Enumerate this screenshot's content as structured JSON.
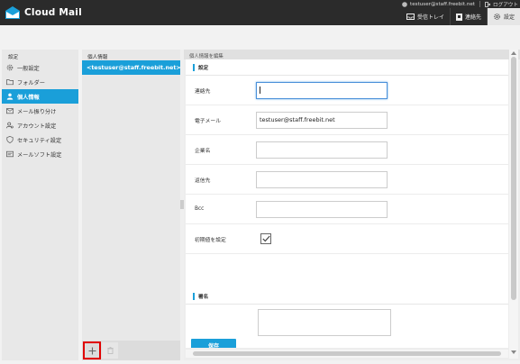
{
  "app": {
    "name": "Cloud Mail"
  },
  "account": {
    "email": "testuser@staff.freebit.net",
    "logout_label": "ログアウト"
  },
  "nav": {
    "inbox_label": "受信トレイ",
    "contacts_label": "連絡先",
    "settings_label": "設定"
  },
  "sidebar": {
    "title": "設定",
    "items": [
      {
        "label": "一般設定",
        "icon": "gear-icon"
      },
      {
        "label": "フォルダー",
        "icon": "folder-icon"
      },
      {
        "label": "個人情報",
        "icon": "person-icon",
        "active": true
      },
      {
        "label": "メール振り分け",
        "icon": "mail-filter-icon"
      },
      {
        "label": "アカウント設定",
        "icon": "account-icon"
      },
      {
        "label": "セキュリティ設定",
        "icon": "shield-icon"
      },
      {
        "label": "メールソフト設定",
        "icon": "mail-client-icon"
      }
    ]
  },
  "identities": {
    "title": "個人情報",
    "items": [
      {
        "label": "<testuser@staff.freebit.net>"
      }
    ]
  },
  "editor": {
    "header": "個人情報を編集",
    "settings_section": "設定",
    "fields": {
      "display_name": {
        "label": "連絡先",
        "value": ""
      },
      "email": {
        "label": "電子メール",
        "value": "testuser@staff.freebit.net"
      },
      "organization": {
        "label": "企業名",
        "value": ""
      },
      "reply_to": {
        "label": "返信先",
        "value": ""
      },
      "bcc": {
        "label": "Bcc",
        "value": ""
      },
      "default": {
        "label": "初期値を設定",
        "checked": true
      }
    },
    "signature_section": "署名",
    "save_label": "保存"
  },
  "colors": {
    "accent": "#1a9fd9",
    "topbar": "#2b2b2b",
    "highlight": "#e00000"
  }
}
